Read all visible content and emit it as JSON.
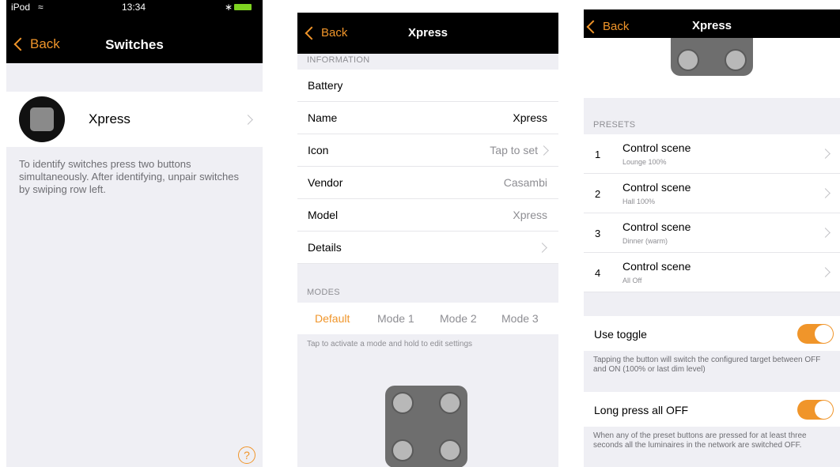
{
  "panel1": {
    "status": {
      "carrier": "iPod",
      "time": "13:34"
    },
    "back_label": "Back",
    "title": "Switches",
    "switch_name": "Xpress",
    "hint": "To identify switches press two buttons simultaneously. After identifying, unpair switches by swiping row left.",
    "help_glyph": "?"
  },
  "panel2": {
    "back_label": "Back",
    "title": "Xpress",
    "information_header": "INFORMATION",
    "rows": [
      {
        "label": "Battery",
        "value": ""
      },
      {
        "label": "Name",
        "value": "Xpress"
      },
      {
        "label": "Icon",
        "value": "Tap to set"
      },
      {
        "label": "Vendor",
        "value": "Casambi"
      },
      {
        "label": "Model",
        "value": "Xpress"
      },
      {
        "label": "Details",
        "value": ""
      }
    ],
    "modes_header": "MODES",
    "modes": [
      "Default",
      "Mode 1",
      "Mode 2",
      "Mode 3"
    ],
    "modes_hint": "Tap to activate a mode and hold to edit settings"
  },
  "panel3": {
    "back_label": "Back",
    "title": "Xpress",
    "presets_header": "PRESETS",
    "presets": [
      {
        "num": "1",
        "title": "Control scene",
        "sub": "Lounge 100%"
      },
      {
        "num": "2",
        "title": "Control scene",
        "sub": "Hall 100%"
      },
      {
        "num": "3",
        "title": "Control scene",
        "sub": "Dinner (warm)"
      },
      {
        "num": "4",
        "title": "Control scene",
        "sub": "All Off"
      }
    ],
    "use_toggle_label": "Use toggle",
    "use_toggle_note": "Tapping the button will switch the configured target between OFF and ON (100% or last dim level)",
    "long_press_label": "Long press all OFF",
    "long_press_note": "When any of the preset buttons are pressed for at least three seconds all the luminaires in the network are switched OFF."
  },
  "colors": {
    "accent": "#f0952a",
    "navbar": "#000000",
    "background": "#efeff4"
  }
}
